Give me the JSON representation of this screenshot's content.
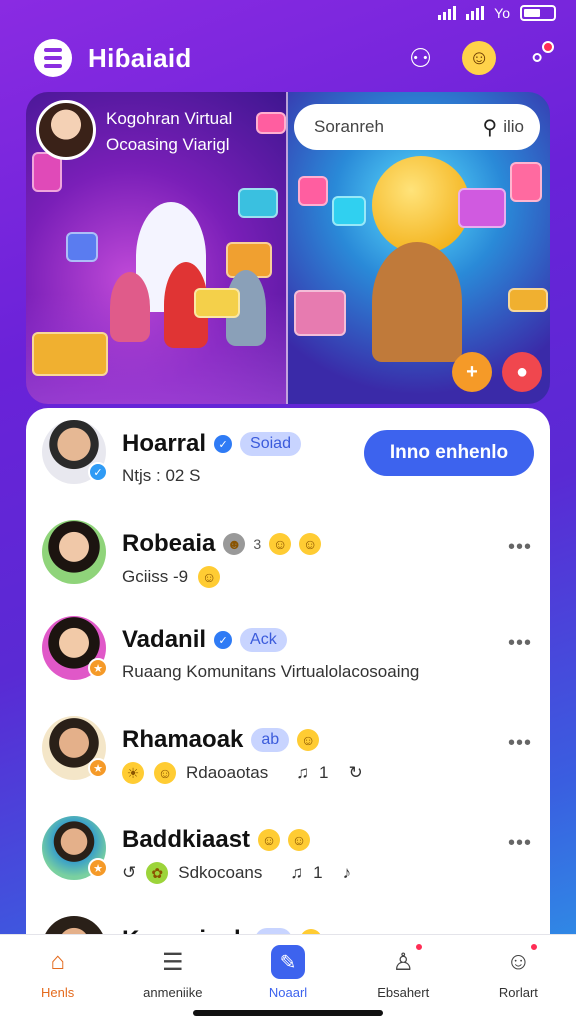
{
  "status_bar": {
    "carrier": "Yo"
  },
  "header": {
    "title": "Hiɓaiaid",
    "icons": [
      "user-group-icon",
      "emoji-face-icon",
      "share-network-icon"
    ]
  },
  "hero": {
    "caption_line1": "Kogohran Virtual",
    "caption_line2": "Ocoasing Viarigl",
    "search_placeholder": "Soranreh",
    "search_right_label": "ilio"
  },
  "feed": {
    "follow_button_label": "Inno enhenlo",
    "posts": [
      {
        "name": "Hoarral",
        "tag": "Soiad",
        "sub": "Ntjs : 02  S",
        "verified": true
      },
      {
        "name": "Robeaia",
        "sub": "Gciiss -9",
        "extra": "3"
      },
      {
        "name": "Vadanil",
        "tag": "Ack",
        "sub": "Ruaang Komunitans Virtualolacosoaing",
        "verified": true
      },
      {
        "name": "Rhamaoak",
        "tag": "ab",
        "sub": "Rdaoaotas",
        "count": "1"
      },
      {
        "name": "Baddkiaast",
        "sub": "Sdkocoans",
        "count": "1"
      },
      {
        "name": "Komoriaok",
        "tag": "se"
      }
    ]
  },
  "nav": {
    "items": [
      {
        "label": "Henls"
      },
      {
        "label": "anmeniike"
      },
      {
        "label": "Noaarl"
      },
      {
        "label": "Ebsahert"
      },
      {
        "label": "Rorlart"
      }
    ]
  },
  "colors": {
    "accent": "#3d63ee",
    "home": "#e46b1e",
    "bg_top": "#8a2be2",
    "bg_bottom": "#2aa0e8"
  }
}
